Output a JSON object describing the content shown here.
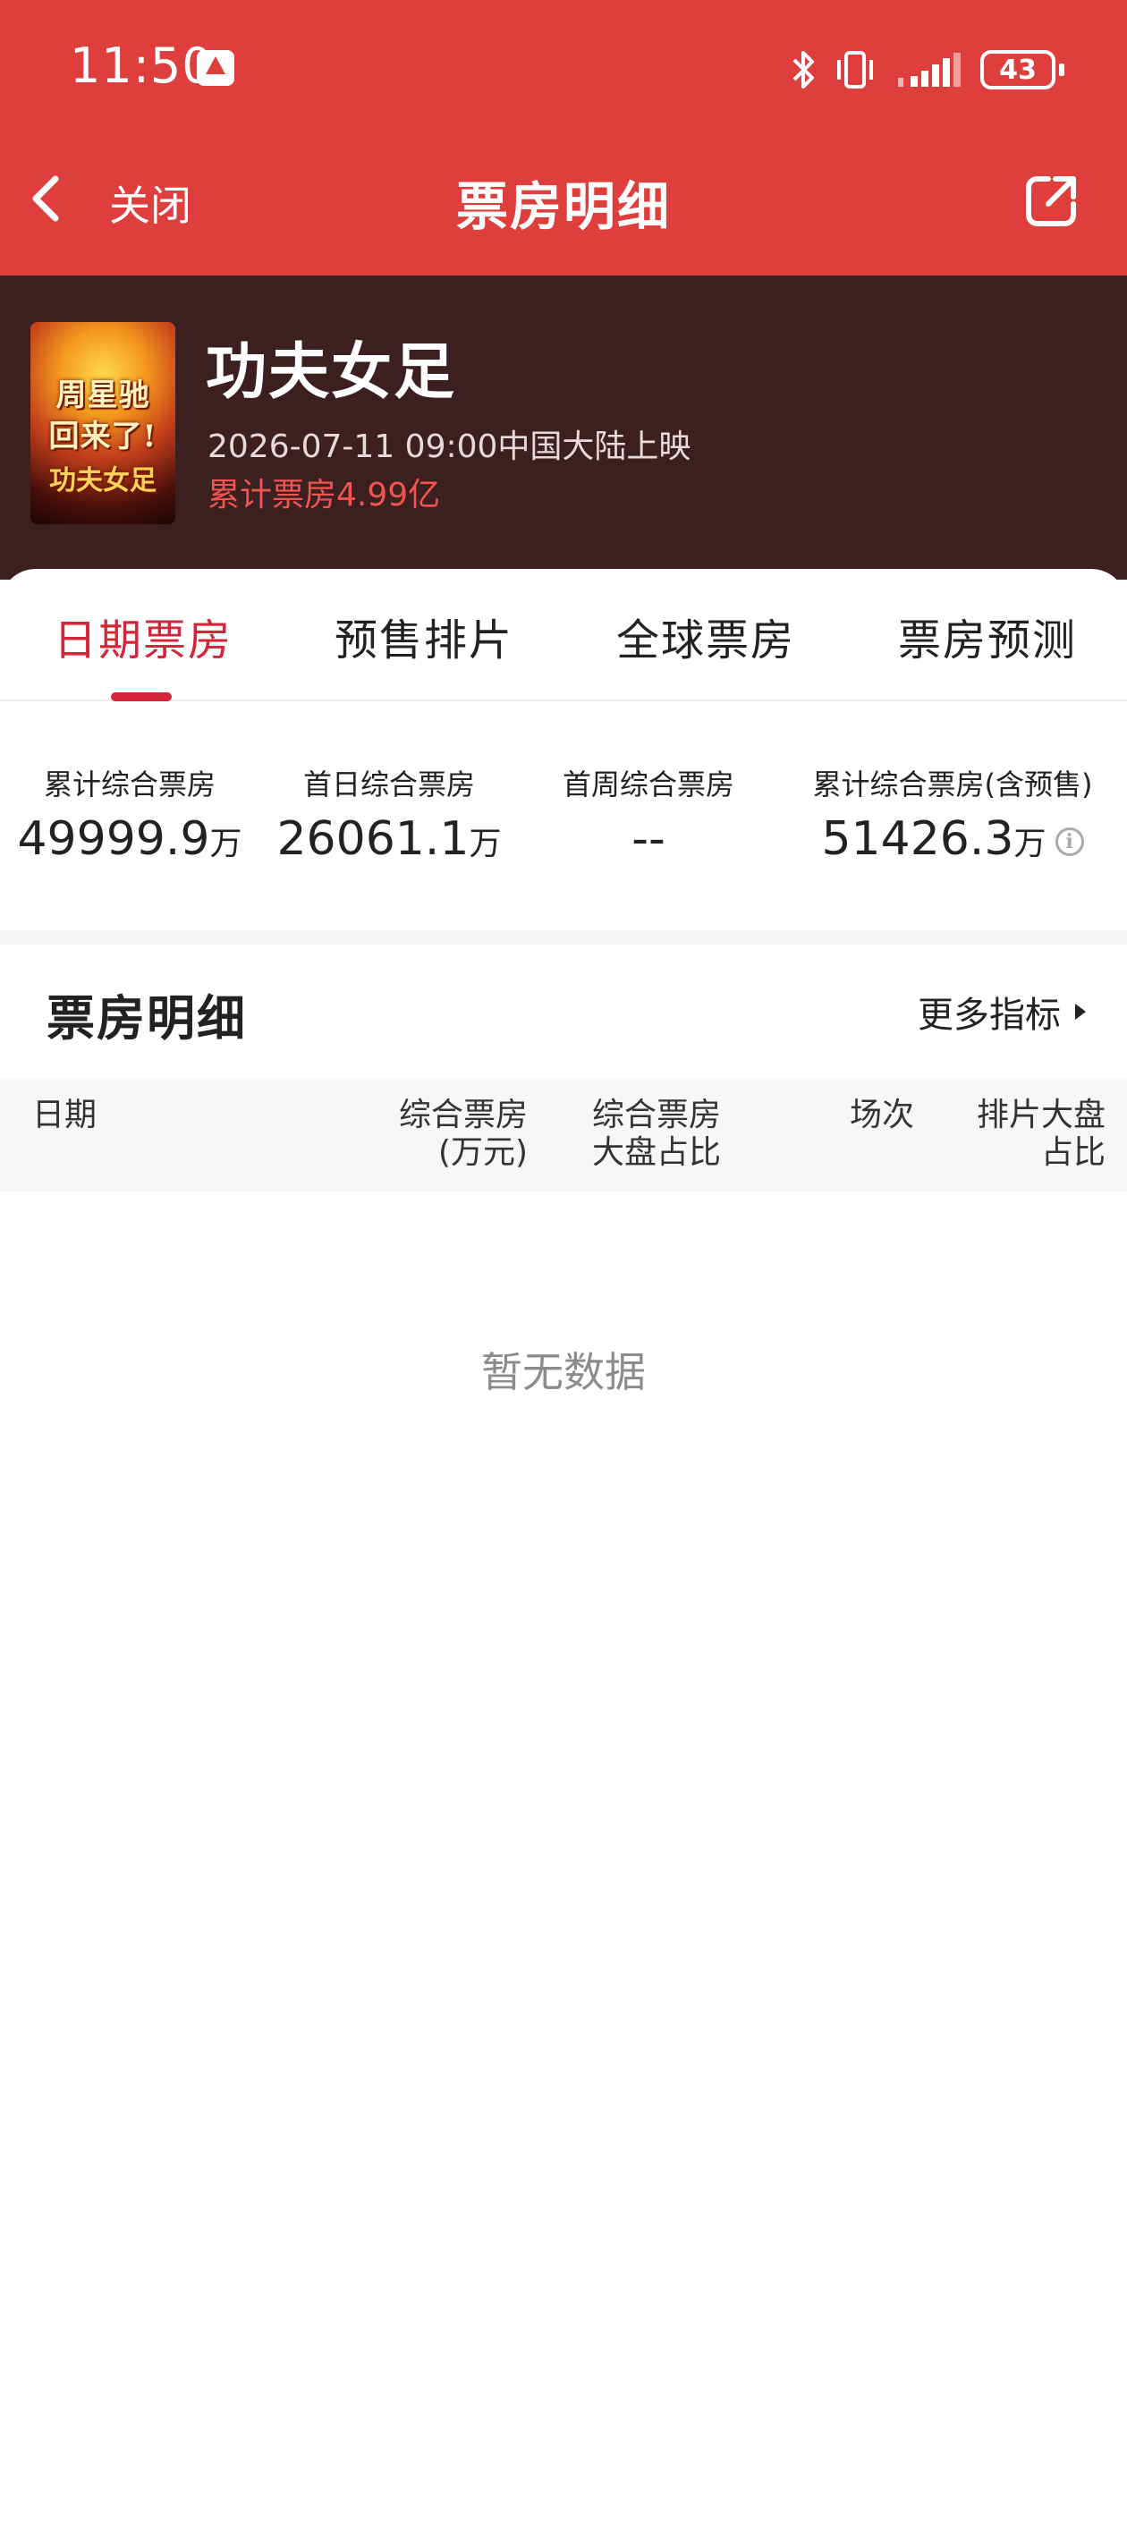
{
  "status_bar": {
    "time": "11:50",
    "battery": "43",
    "icons": [
      "app-notification-icon",
      "bluetooth-icon",
      "vibrate-icon",
      "signal-icon",
      "battery-icon"
    ]
  },
  "nav": {
    "close_label": "关闭",
    "title": "票房明细",
    "icons": [
      "chevron-left-icon",
      "share-icon"
    ]
  },
  "movie": {
    "title": "功夫女足",
    "release": "2026-07-11 09:00中国大陆上映",
    "total_box_office": "累计票房4.99亿",
    "poster_lines": [
      "周星驰",
      "回来了!",
      "功夫女足"
    ]
  },
  "tabs": [
    {
      "label": "日期票房",
      "active": true
    },
    {
      "label": "预售排片",
      "active": false
    },
    {
      "label": "全球票房",
      "active": false
    },
    {
      "label": "票房预测",
      "active": false
    }
  ],
  "stats": [
    {
      "label": "累计综合票房",
      "value": "49999.9",
      "unit": "万"
    },
    {
      "label": "首日综合票房",
      "value": "26061.1",
      "unit": "万"
    },
    {
      "label": "首周综合票房",
      "value": "--",
      "unit": ""
    },
    {
      "label": "累计综合票房(含预售)",
      "value": "51426.3",
      "unit": "万"
    }
  ],
  "section": {
    "title": "票房明细",
    "more_label": "更多指标"
  },
  "table": {
    "columns": [
      {
        "line1": "日期",
        "line2": ""
      },
      {
        "line1": "综合票房",
        "line2": "(万元)"
      },
      {
        "line1": "综合票房",
        "line2": "大盘占比"
      },
      {
        "line1": "场次",
        "line2": ""
      },
      {
        "line1": "排片大盘",
        "line2": "占比"
      }
    ],
    "empty_text": "暂无数据"
  },
  "colors": {
    "nav_red": "#de3f3d",
    "header_dark": "#3c1f1f",
    "accent_red": "#d4253a",
    "total_red": "#f05453"
  }
}
